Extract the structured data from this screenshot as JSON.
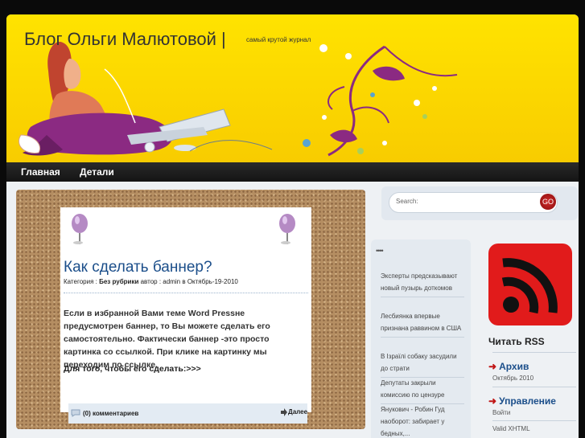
{
  "header": {
    "title": "Блог Ольги Малютовой",
    "separator": "|",
    "tagline": "самый крутой журнал"
  },
  "nav": {
    "items": [
      "Главная",
      "Детали"
    ]
  },
  "post": {
    "title": "Как сделать баннер?",
    "category_label": "Категория :",
    "category": "Без рубрики",
    "author_label": "автор :",
    "author": "admin",
    "date_label": "в",
    "date": "Октябрь-19-2010",
    "body": "Если в избранной Вами теме  Word  Pressне предусмотрен баннер, то Вы можете сделать его самостоятельно. Фактически баннер   -это просто картинка со ссылкой. При клике на картинку мы переходим по ссылке.",
    "body2": "Для того, чтобы его сделать:>>>",
    "comments": "(0) комментариев",
    "more": "Далее"
  },
  "search": {
    "placeholder": "Search:",
    "button": "GO"
  },
  "news": {
    "heading": "••••",
    "items": [
      "Эксперты предсказывают новый пузырь доткомов",
      "Лесбиянка впервые признана раввином в США",
      "В Ізраїлі собаку засудили до страти",
      "Депутаты закрыли комиссию по цензуре",
      "Янукович - Робин Гуд наоборот: забирает у бедных,..."
    ]
  },
  "sidebar": {
    "rss_label": "Читать RSS",
    "archive": {
      "title": "Архив",
      "items": [
        "Октябрь 2010"
      ]
    },
    "manage": {
      "title": "Управление",
      "items": [
        "Войти",
        "Valid XHTML"
      ]
    }
  },
  "colors": {
    "header_bg": "#ffd400",
    "nav_bg": "#1c1c1c",
    "link": "#1b4e8a",
    "rss": "#e11b1b"
  }
}
